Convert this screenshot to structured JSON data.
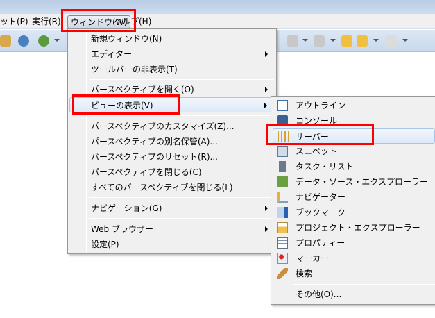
{
  "menubar": {
    "items": [
      {
        "label": "ット(P)"
      },
      {
        "label": "実行(R)"
      },
      {
        "label": "ウィンドウ(W)"
      },
      {
        "label": "ヘルプ(H)"
      }
    ]
  },
  "window_menu": {
    "items": [
      {
        "label": "新規ウィンドウ(N)"
      },
      {
        "label": "エディター",
        "submenu": true
      },
      {
        "label": "ツールバーの非表示(T)"
      },
      {
        "label": "パースペクティブを開く(O)",
        "submenu": true
      },
      {
        "label": "ビューの表示(V)",
        "submenu": true,
        "highlighted": true
      },
      {
        "label": "パースペクティブのカスタマイズ(Z)..."
      },
      {
        "label": "パースペクティブの別名保管(A)..."
      },
      {
        "label": "パースペクティブのリセット(R)..."
      },
      {
        "label": "パースペクティブを閉じる(C)"
      },
      {
        "label": "すべてのパースペクティブを閉じる(L)"
      },
      {
        "label": "ナビゲーション(G)",
        "submenu": true
      },
      {
        "label": "Web ブラウザー",
        "submenu": true
      },
      {
        "label": "設定(P)"
      }
    ]
  },
  "view_menu": {
    "items": [
      {
        "label": "アウトライン",
        "icon": "outline-icon"
      },
      {
        "label": "コンソール",
        "icon": "console-icon"
      },
      {
        "label": "サーバー",
        "icon": "servers-icon",
        "highlighted": true
      },
      {
        "label": "スニペット",
        "icon": "snippets-icon"
      },
      {
        "label": "タスク・リスト",
        "icon": "task-list-icon"
      },
      {
        "label": "データ・ソース・エクスプローラー",
        "icon": "data-source-icon"
      },
      {
        "label": "ナビゲーター",
        "icon": "navigator-icon"
      },
      {
        "label": "ブックマーク",
        "icon": "bookmark-icon"
      },
      {
        "label": "プロジェクト・エクスプローラー",
        "icon": "project-explorer-icon"
      },
      {
        "label": "プロパティー",
        "icon": "properties-icon"
      },
      {
        "label": "マーカー",
        "icon": "markers-icon"
      },
      {
        "label": "検索",
        "icon": "search-icon"
      },
      {
        "label": "その他(O)..."
      }
    ]
  },
  "colors": {
    "annotation": "#ff0000",
    "highlight": "#dde9f8"
  }
}
